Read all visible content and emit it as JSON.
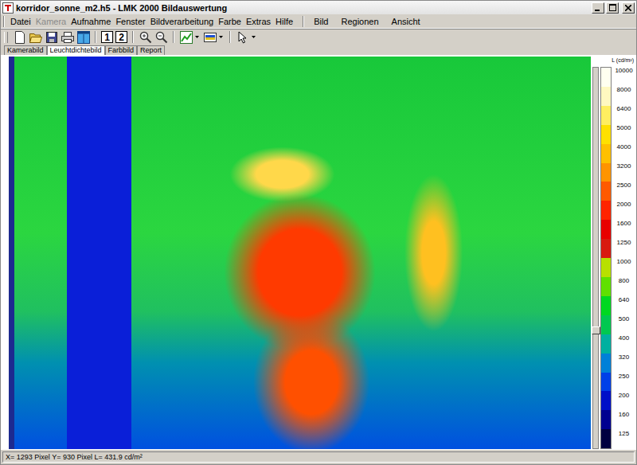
{
  "window": {
    "title": "korridor_sonne_m2.h5 - LMK 2000 Bildauswertung"
  },
  "menu": [
    {
      "label": "Datei",
      "disabled": false
    },
    {
      "label": "Kamera",
      "disabled": true
    },
    {
      "label": "Aufnahme",
      "disabled": false
    },
    {
      "label": "Fenster",
      "disabled": false
    },
    {
      "label": "Bildverarbeitung",
      "disabled": false
    },
    {
      "label": "Farbe",
      "disabled": false
    },
    {
      "label": "Extras",
      "disabled": false
    },
    {
      "label": "Hilfe",
      "disabled": false
    }
  ],
  "menu_secondary": [
    {
      "label": "Bild"
    },
    {
      "label": "Regionen"
    },
    {
      "label": "Ansicht"
    }
  ],
  "toolbar": {
    "page_buttons": [
      "1",
      "2"
    ]
  },
  "tabs": [
    {
      "label": "Kamerabild",
      "selected": false
    },
    {
      "label": "Leuchtdichtebild",
      "selected": true
    },
    {
      "label": "Farbbild",
      "selected": false
    },
    {
      "label": "Report",
      "selected": false
    }
  ],
  "scale": {
    "title": "L (cd/m²)",
    "ticks": [
      {
        "label": "10000",
        "color": "#fffff0"
      },
      {
        "label": "8000",
        "color": "#fff8c0"
      },
      {
        "label": "6400",
        "color": "#ffee60"
      },
      {
        "label": "5000",
        "color": "#ffe000"
      },
      {
        "label": "4000",
        "color": "#ffc000"
      },
      {
        "label": "3200",
        "color": "#ff9400"
      },
      {
        "label": "2500",
        "color": "#ff5a00"
      },
      {
        "label": "2000",
        "color": "#ff2400"
      },
      {
        "label": "1600",
        "color": "#e80000"
      },
      {
        "label": "1250",
        "color": "#d81a10"
      },
      {
        "label": "1000",
        "color": "#b8e000"
      },
      {
        "label": "800",
        "color": "#60e000"
      },
      {
        "label": "640",
        "color": "#00d820"
      },
      {
        "label": "500",
        "color": "#00c850"
      },
      {
        "label": "400",
        "color": "#00b0a0"
      },
      {
        "label": "320",
        "color": "#0080d8"
      },
      {
        "label": "250",
        "color": "#0040e8"
      },
      {
        "label": "200",
        "color": "#0010c8"
      },
      {
        "label": "160",
        "color": "#000090"
      },
      {
        "label": "125",
        "color": "#000040"
      }
    ],
    "slider": {
      "level": 0.31
    }
  },
  "status_bar": {
    "text": "X= 1293 Pixel Y= 930 Pixel L= 431.9 cd/m²"
  }
}
